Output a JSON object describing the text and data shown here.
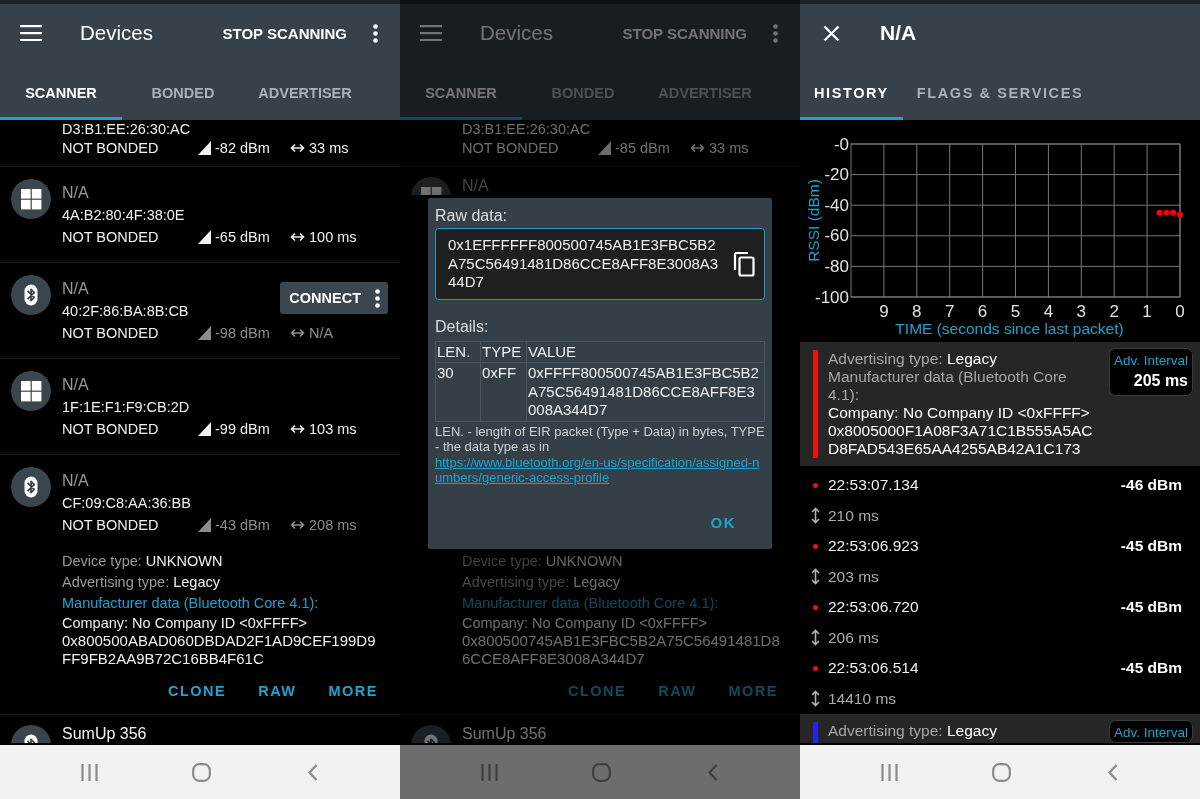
{
  "screens": [
    {
      "kind": "scanner",
      "app_bar": {
        "title": "Devices",
        "action": "STOP SCANNING"
      },
      "tabs": [
        {
          "label": "SCANNER",
          "selected": true
        },
        {
          "label": "BONDED",
          "selected": false
        },
        {
          "label": "ADVERTISER",
          "selected": false
        }
      ],
      "devices": [
        {
          "address": "D3:B1:EE:26:30:AC",
          "bond_state": "NOT BONDED",
          "rssi": "-82 dBm",
          "interval": "33 ms",
          "stale": false
        },
        {
          "kind": "windows",
          "name": "N/A",
          "name_known": false,
          "address": "4A:B2:80:4F:38:0E",
          "bond_state": "NOT BONDED",
          "rssi": "-65 dBm",
          "interval": "100 ms",
          "stale": false
        },
        {
          "kind": "bluetooth",
          "name": "N/A",
          "name_known": false,
          "address": "40:2F:86:BA:8B:CB",
          "bond_state": "NOT BONDED",
          "rssi": "-98 dBm",
          "interval": "N/A",
          "stale": true,
          "connect_button": "CONNECT"
        },
        {
          "kind": "windows",
          "name": "N/A",
          "name_known": false,
          "address": "1F:1E:F1:F9:CB:2D",
          "bond_state": "NOT BONDED",
          "rssi": "-99 dBm",
          "interval": "103 ms",
          "stale": false
        },
        {
          "kind": "bluetooth",
          "name": "N/A",
          "name_known": false,
          "address": "CF:09:C8:AA:36:BB",
          "bond_state": "NOT BONDED",
          "rssi": "-43 dBm",
          "interval": "208 ms",
          "stale": true,
          "details": [
            {
              "label": "Device type:",
              "value": "UNKNOWN"
            },
            {
              "label": "Advertising type:",
              "value": "Legacy"
            }
          ],
          "manufacturer_data": {
            "title": "Manufacturer data (Bluetooth Core 4.1):",
            "company": "Company: No Company ID <0xFFFF>",
            "data": "0x800500ABAD060DBDAD2F1AD9CEF199D9FF9FB2AA9B72C16BB4F61C"
          },
          "actions": [
            "CLONE",
            "RAW",
            "MORE"
          ]
        },
        {
          "kind": "bluetooth",
          "name": "SumUp 356",
          "name_known": true
        }
      ]
    },
    {
      "kind": "scanner",
      "app_bar": {
        "title": "Devices",
        "action": "STOP SCANNING"
      },
      "tabs": [
        {
          "label": "SCANNER",
          "selected": true
        },
        {
          "label": "BONDED",
          "selected": false
        },
        {
          "label": "ADVERTISER",
          "selected": false
        }
      ],
      "devices": [
        {
          "address": "D3:B1:EE:26:30:AC",
          "bond_state": "NOT BONDED",
          "rssi": "-85 dBm",
          "interval": "33 ms",
          "stale": false
        },
        {
          "kind": "windows",
          "name": "N/A",
          "name_known": false
        },
        {
          "details": [
            {
              "label": "Device type:",
              "value": "UNKNOWN"
            },
            {
              "label": "Advertising type:",
              "value": "Legacy"
            }
          ],
          "manufacturer_data": {
            "title": "Manufacturer data (Bluetooth Core 4.1):",
            "company": "Company: No Company ID <0xFFFF>",
            "data": "0x800500745AB1E3FBC5B2A75C56491481D86CCE8AFF8E3008A344D7"
          },
          "actions": [
            "CLONE",
            "RAW",
            "MORE"
          ]
        },
        {
          "kind": "bluetooth",
          "name": "SumUp 356",
          "name_known": true
        }
      ],
      "dialog": {
        "title": "Raw data:",
        "raw_data": "0x1EFFFFFF800500745AB1E3FBC5B2A75C56491481D86CCE8AFF8E3008A344D7",
        "details_title": "Details:",
        "table": {
          "columns": [
            "LEN.",
            "TYPE",
            "VALUE"
          ],
          "rows": [
            [
              "30",
              "0xFF",
              "0xFFFF800500745AB1E3FBC5B2A75C56491481D86CCE8AFF8E3008A344D7"
            ]
          ]
        },
        "note": "LEN. - length of EIR packet (Type + Data) in bytes, TYPE - the data type as in",
        "link": "https://www.bluetooth.org/en-us/specification/assigned-numbers/generic-access-profile",
        "button": "OK"
      }
    },
    {
      "kind": "history",
      "app_bar": {
        "title": "N/A"
      },
      "tabs": [
        {
          "label": "HISTORY",
          "selected": true
        },
        {
          "label": "FLAGS & SERVICES",
          "selected": false
        }
      ],
      "chart_data": {
        "type": "scatter",
        "xlabel": "TIME (seconds since last packet)",
        "ylabel": "RSSI (dBm)",
        "x": [
          0,
          0.21,
          0.41,
          0.62
        ],
        "series": [
          {
            "color": "#ff0000",
            "values": [
              -46,
              -45,
              -45,
              -45
            ]
          }
        ],
        "xlim": [
          10,
          0
        ],
        "ylim": [
          -100,
          0
        ],
        "xticks": [
          9,
          8,
          7,
          6,
          5,
          4,
          3,
          2,
          1,
          0
        ],
        "yticks": [
          {
            "value": 0,
            "label": "-0"
          },
          -20,
          -40,
          -60,
          -80,
          -100
        ],
        "grid": true
      },
      "groups": [
        {
          "color": "#f01010",
          "advertising_type": {
            "label": "Advertising type:",
            "value": "Legacy"
          },
          "manufacturer_title": "Manufacturer data (Bluetooth Core 4.1):",
          "company": "Company: No Company ID <0xFFFF>",
          "data": "0x8005000F1A08F3A71C1B555A5ACD8FAD543E65AA4255AB42A1C173",
          "interval": {
            "label": "Adv. Interval",
            "value": "205 ms"
          },
          "packets": [
            {
              "time": "22:53:07.134",
              "rssi": "-46 dBm",
              "delta": "210 ms"
            },
            {
              "time": "22:53:06.923",
              "rssi": "-45 dBm",
              "delta": "203 ms"
            },
            {
              "time": "22:53:06.720",
              "rssi": "-45 dBm",
              "delta": "206 ms"
            },
            {
              "time": "22:53:06.514",
              "rssi": "-45 dBm",
              "delta": "14410 ms"
            }
          ]
        },
        {
          "color": "#2424f0",
          "advertising_type": {
            "label": "Advertising type:",
            "value": "Legacy"
          },
          "interval": {
            "label": "Adv. Interval"
          }
        }
      ]
    }
  ]
}
